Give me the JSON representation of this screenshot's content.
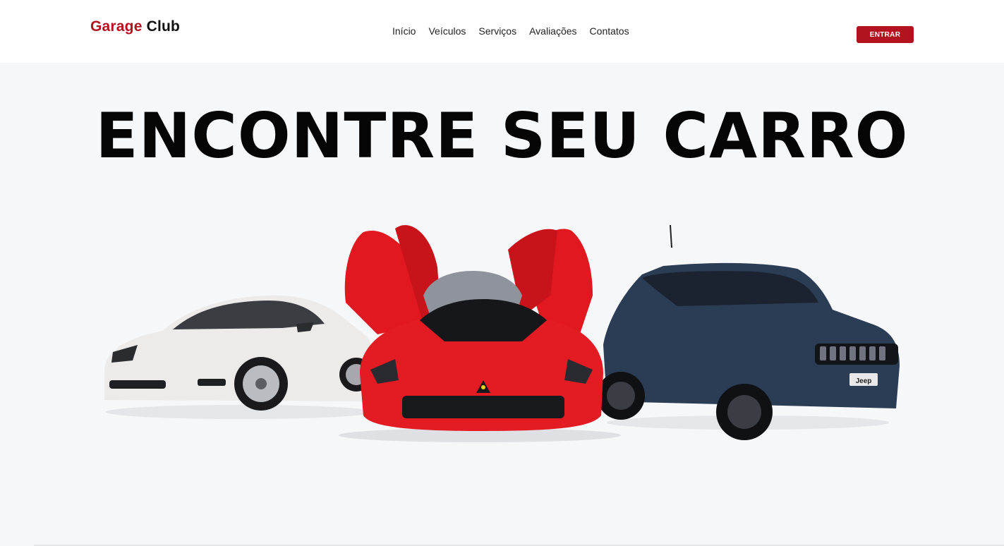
{
  "header": {
    "logo": {
      "part1": "Garage",
      "part2": "Club"
    },
    "nav": [
      "Início",
      "Veículos",
      "Serviços",
      "Avaliações",
      "Contatos"
    ],
    "login_label": "ENTRAR"
  },
  "hero": {
    "title": "ENCONTRE SEU CARRO",
    "jeep_badge": "Jeep",
    "cars": [
      "white-porsche-coupe",
      "red-ferrari-supercar",
      "blue-jeep-suv"
    ]
  },
  "colors": {
    "brand": "#b3121f",
    "text": "#111111",
    "background": "#f6f7f9",
    "header_bg": "#ffffff"
  }
}
